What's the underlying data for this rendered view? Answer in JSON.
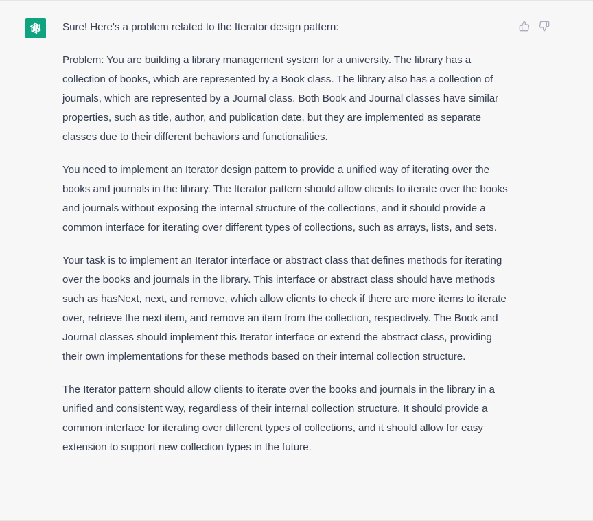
{
  "assistant": {
    "avatar_icon": "openai-logo-icon",
    "brand_color": "#10a37f"
  },
  "feedback": {
    "thumbs_up_icon": "thumbs-up-icon",
    "thumbs_down_icon": "thumbs-down-icon"
  },
  "message": {
    "intro": "Sure! Here's a problem related to the Iterator design pattern:",
    "paragraphs": [
      "Problem: You are building a library management system for a university. The library has a collection of books, which are represented by a Book class. The library also has a collection of journals, which are represented by a Journal class. Both Book and Journal classes have similar properties, such as title, author, and publication date, but they are implemented as separate classes due to their different behaviors and functionalities.",
      "You need to implement an Iterator design pattern to provide a unified way of iterating over the books and journals in the library. The Iterator pattern should allow clients to iterate over the books and journals without exposing the internal structure of the collections, and it should provide a common interface for iterating over different types of collections, such as arrays, lists, and sets.",
      "Your task is to implement an Iterator interface or abstract class that defines methods for iterating over the books and journals in the library. This interface or abstract class should have methods such as hasNext, next, and remove, which allow clients to check if there are more items to iterate over, retrieve the next item, and remove an item from the collection, respectively. The Book and Journal classes should implement this Iterator interface or extend the abstract class, providing their own implementations for these methods based on their internal collection structure.",
      "The Iterator pattern should allow clients to iterate over the books and journals in the library in a unified and consistent way, regardless of their internal collection structure. It should provide a common interface for iterating over different types of collections, and it should allow for easy extension to support new collection types in the future."
    ]
  }
}
